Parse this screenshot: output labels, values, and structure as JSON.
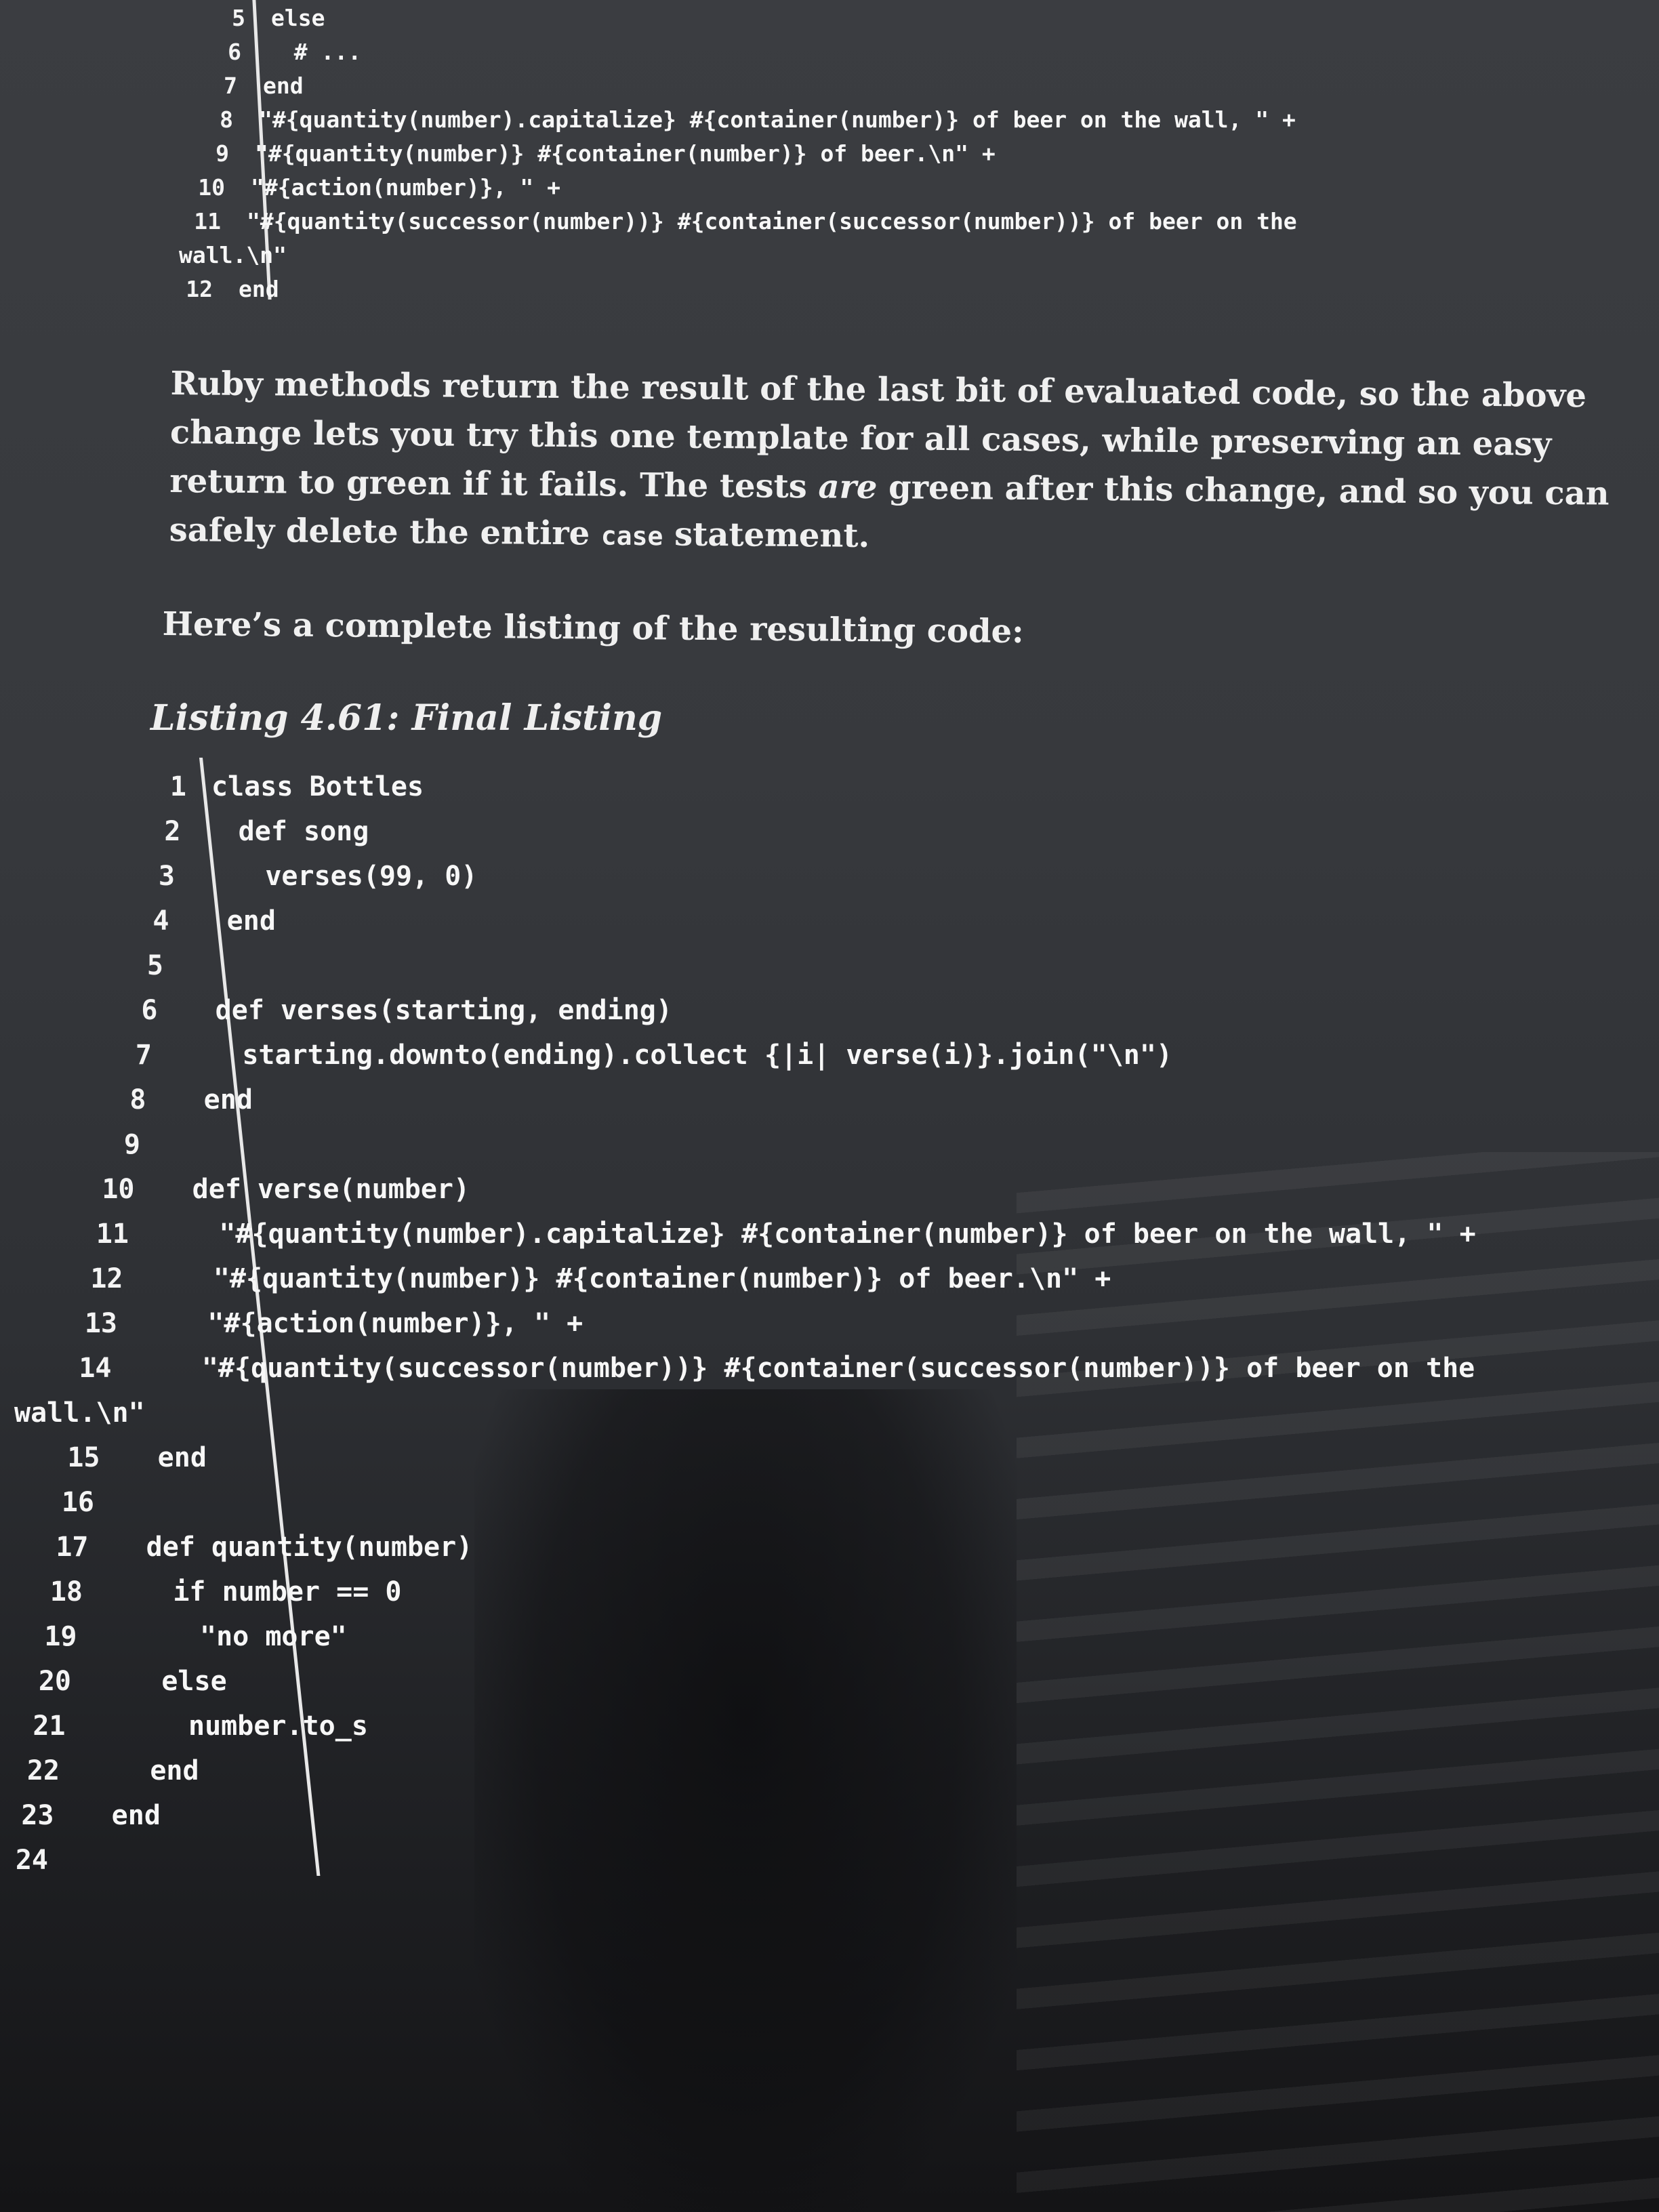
{
  "top_listing": {
    "lines": [
      {
        "n": "5",
        "code": "else"
      },
      {
        "n": "6",
        "code": "  # ..."
      },
      {
        "n": "7",
        "code": "end"
      },
      {
        "n": "8",
        "code": "\"#{quantity(number).capitalize} #{container(number)} of beer on the wall, \" +"
      },
      {
        "n": "9",
        "code": "\"#{quantity(number)} #{container(number)} of beer.\\n\" +"
      },
      {
        "n": "10",
        "code": "\"#{action(number)}, \" +"
      },
      {
        "n": "11",
        "code": "\"#{quantity(successor(number))} #{container(successor(number))} of beer on the"
      },
      {
        "n": "",
        "code": "wall.\\n\""
      },
      {
        "n": "12",
        "code": "end"
      }
    ]
  },
  "paragraph1": {
    "part1": "Ruby methods return the result of the last bit of evaluated code, so the above change lets you try this one template for all cases, while preserving an easy return to green if it fails. The tests ",
    "emph": "are",
    "part2": " green after this change, and so you can safely delete the entire ",
    "code": "case",
    "part3": " statement."
  },
  "paragraph2": "Here’s a complete listing of the resulting code:",
  "caption": "Listing 4.61: Final Listing",
  "final_listing": {
    "lines": [
      {
        "n": "1",
        "code": "class Bottles"
      },
      {
        "n": "2",
        "code": "  def song"
      },
      {
        "n": "3",
        "code": "    verses(99, 0)"
      },
      {
        "n": "4",
        "code": "  end"
      },
      {
        "n": "5",
        "code": ""
      },
      {
        "n": "6",
        "code": "  def verses(starting, ending)"
      },
      {
        "n": "7",
        "code": "    starting.downto(ending).collect {|i| verse(i)}.join(\"\\n\")"
      },
      {
        "n": "8",
        "code": "  end"
      },
      {
        "n": "9",
        "code": ""
      },
      {
        "n": "10",
        "code": "  def verse(number)"
      },
      {
        "n": "11",
        "code": "    \"#{quantity(number).capitalize} #{container(number)} of beer on the wall, \" +"
      },
      {
        "n": "12",
        "code": "    \"#{quantity(number)} #{container(number)} of beer.\\n\" +"
      },
      {
        "n": "13",
        "code": "    \"#{action(number)}, \" +"
      },
      {
        "n": "14",
        "code": "    \"#{quantity(successor(number))} #{container(successor(number))} of beer on the"
      },
      {
        "n": "",
        "code": "wall.\\n\""
      },
      {
        "n": "15",
        "code": "  end"
      },
      {
        "n": "16",
        "code": ""
      },
      {
        "n": "17",
        "code": "  def quantity(number)"
      },
      {
        "n": "18",
        "code": "    if number == 0"
      },
      {
        "n": "19",
        "code": "      \"no more\""
      },
      {
        "n": "20",
        "code": "    else"
      },
      {
        "n": "21",
        "code": "      number.to_s"
      },
      {
        "n": "22",
        "code": "    end"
      },
      {
        "n": "23",
        "code": "  end"
      },
      {
        "n": "24",
        "code": ""
      }
    ]
  }
}
